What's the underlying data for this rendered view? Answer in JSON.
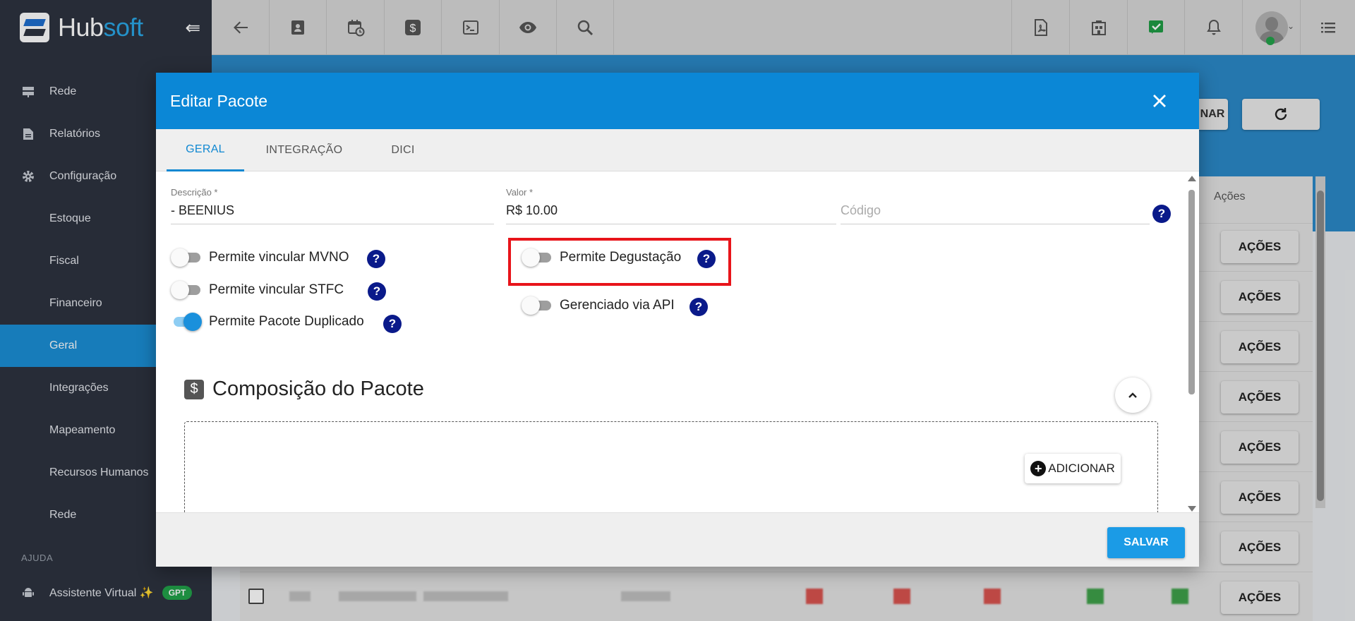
{
  "app": {
    "brand_prefix": "Hub",
    "brand_suffix": "soft"
  },
  "sidebar": {
    "items": [
      {
        "label": "Rede",
        "icon": "server-icon"
      },
      {
        "label": "Relatórios",
        "icon": "document-icon"
      },
      {
        "label": "Configuração",
        "icon": "gear-icon"
      }
    ],
    "subitems": [
      "Estoque",
      "Fiscal",
      "Financeiro",
      "Geral",
      "Integrações",
      "Mapeamento",
      "Recursos Humanos",
      "Rede"
    ],
    "active_subitem": "Geral",
    "section_help": "AJUDA",
    "assistant_label": "Assistente Virtual ✨",
    "assistant_badge": "GPT"
  },
  "background": {
    "partial_button": "NAR",
    "acoes_header": "Ações",
    "acoes_label": "AÇÕES"
  },
  "modal": {
    "title": "Editar Pacote",
    "tabs": [
      "GERAL",
      "INTEGRAÇÃO",
      "DICI"
    ],
    "active_tab": "GERAL",
    "descricao": {
      "label": "Descrição",
      "value": "- BEENIUS"
    },
    "valor": {
      "label": "Valor",
      "value": "R$ 10.00"
    },
    "codigo": {
      "placeholder": "Código"
    },
    "toggles_left": [
      {
        "label": "Permite vincular MVNO",
        "on": false
      },
      {
        "label": "Permite vincular STFC",
        "on": false
      },
      {
        "label": "Permite Pacote Duplicado",
        "on": true
      }
    ],
    "toggles_right": [
      {
        "label": "Permite Degustação",
        "on": false
      },
      {
        "label": "Gerenciado via API",
        "on": false
      }
    ],
    "section_title": "Composição do Pacote",
    "add_label": "ADICIONAR",
    "save_label": "SALVAR"
  },
  "colors": {
    "accent": "#0b87d6",
    "highlight": "#e8141a",
    "help_icon": "#0a1a8a"
  }
}
